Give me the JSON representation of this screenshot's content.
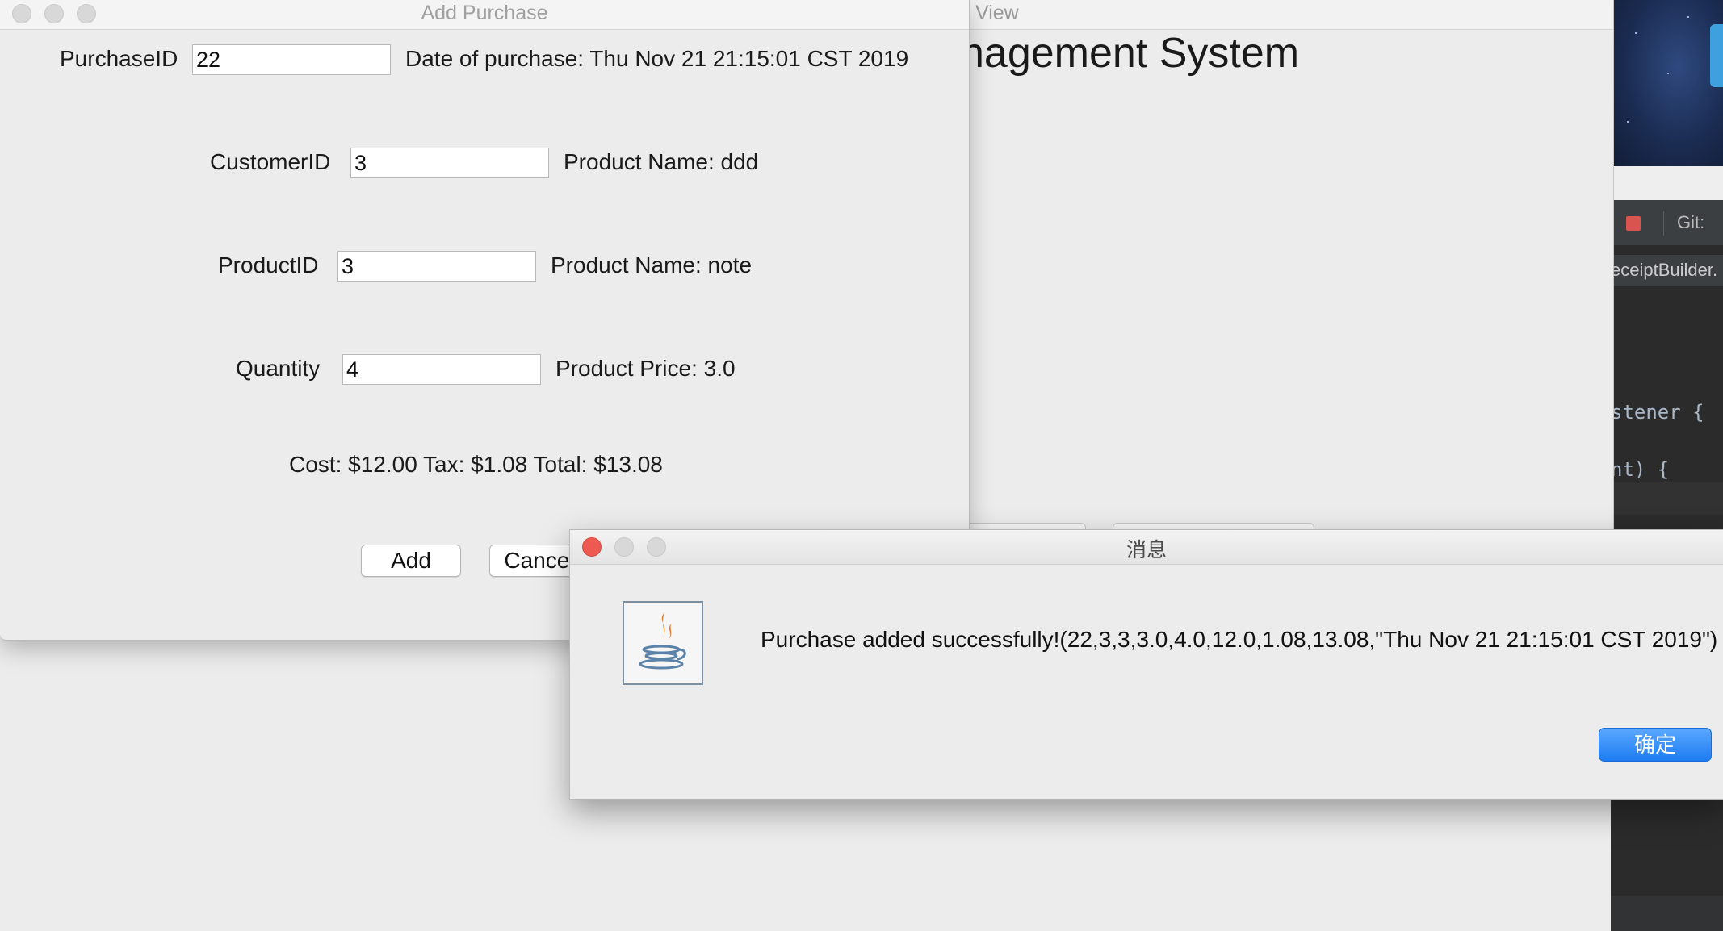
{
  "colors": {
    "ok_button": "#1e7cf2",
    "close_light": "#ee5a52",
    "minimize_light": "#d8d8d8",
    "ide_background": "#2b2b2b",
    "ide_stop": "#d9534f"
  },
  "background_window": {
    "title": "View",
    "heading": "nagement System"
  },
  "ide": {
    "git_label": "Git:",
    "tab_label": "eceiptBuilder.",
    "code_line_1": "stener {",
    "code_line_2": "nt) {"
  },
  "add_purchase": {
    "title": "Add Purchase",
    "purchase_id_label": "PurchaseID",
    "purchase_id_value": "22",
    "date_text": "Date of purchase: Thu Nov 21 21:15:01 CST 2019",
    "customer_id_label": "CustomerID",
    "customer_id_value": "3",
    "customer_name_text": "Product Name: ddd",
    "product_id_label": "ProductID",
    "product_id_value": "3",
    "product_name_text": "Product Name: note",
    "quantity_label": "Quantity",
    "quantity_value": "4",
    "product_price_text": "Product Price: 3.0",
    "totals_text": "Cost: $12.00 Tax: $1.08 Total: $13.08",
    "add_button": "Add",
    "cancel_button": "Cancel"
  },
  "message_dialog": {
    "title": "消息",
    "icon": "java-cup-icon",
    "message": "Purchase added successfully!(22,3,3,3.0,4.0,12.0,1.08,13.08,\"Thu Nov 21 21:15:01 CST 2019\")",
    "ok_button": "确定"
  }
}
